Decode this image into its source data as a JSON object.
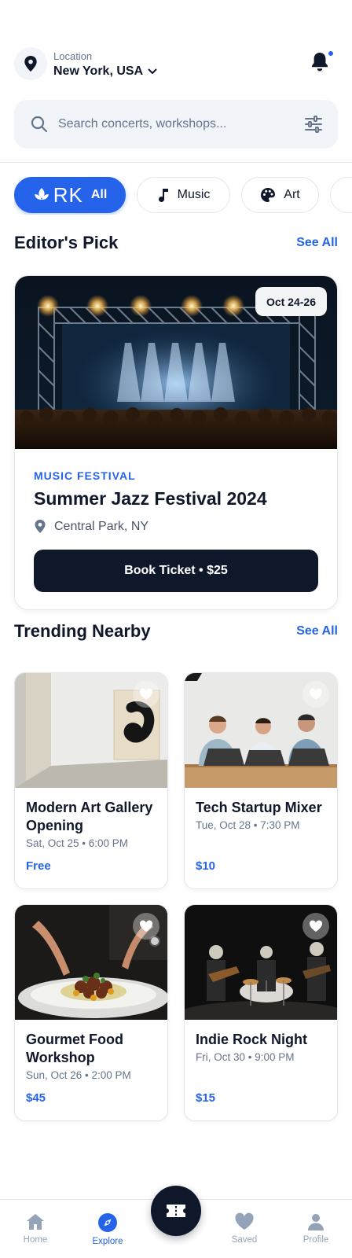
{
  "location": {
    "label": "Location",
    "value": "New York, USA"
  },
  "search": {
    "placeholder": "Search concerts, workshops..."
  },
  "categories": [
    {
      "logo": "RK",
      "label": "All",
      "active": true,
      "icon": "leaf-logo-icon"
    },
    {
      "label": "Music",
      "active": false,
      "icon": "music-note-icon"
    },
    {
      "label": "Art",
      "active": false,
      "icon": "palette-icon"
    }
  ],
  "editors_pick": {
    "title": "Editor's Pick",
    "see_all": "See All",
    "event": {
      "date": "Oct 24-26",
      "category": "MUSIC FESTIVAL",
      "title": "Summer Jazz Festival 2024",
      "venue": "Central Park, NY",
      "cta": "Book Ticket • $25"
    }
  },
  "trending": {
    "title": "Trending Nearby",
    "see_all": "See All",
    "events": [
      {
        "title": "Modern Art Gallery Opening",
        "meta": "Sat, Oct 25 • 6:00 PM",
        "price": "Free",
        "image": "art-gallery"
      },
      {
        "title": "Tech Startup Mixer",
        "meta": "Tue, Oct 28 • 7:30 PM",
        "price": "$10",
        "image": "startup-mixer"
      },
      {
        "title": "Gourmet Food Workshop",
        "meta": "Sun, Oct 26 • 2:00 PM",
        "price": "$45",
        "image": "gourmet-food"
      },
      {
        "title": "Indie Rock Night",
        "meta": "Fri, Oct 30 • 9:00 PM",
        "price": "$15",
        "image": "rock-band"
      }
    ]
  },
  "nav": {
    "items": [
      {
        "label": "Home",
        "icon": "home-icon",
        "active": false
      },
      {
        "label": "Explore",
        "icon": "compass-icon",
        "active": true
      },
      {
        "label": "Saved",
        "icon": "heart-icon",
        "active": false
      },
      {
        "label": "Profile",
        "icon": "user-icon",
        "active": false
      }
    ],
    "center_icon": "ticket-icon"
  },
  "colors": {
    "accent": "#2563eb",
    "dark": "#0f172a",
    "muted": "#64748b"
  }
}
